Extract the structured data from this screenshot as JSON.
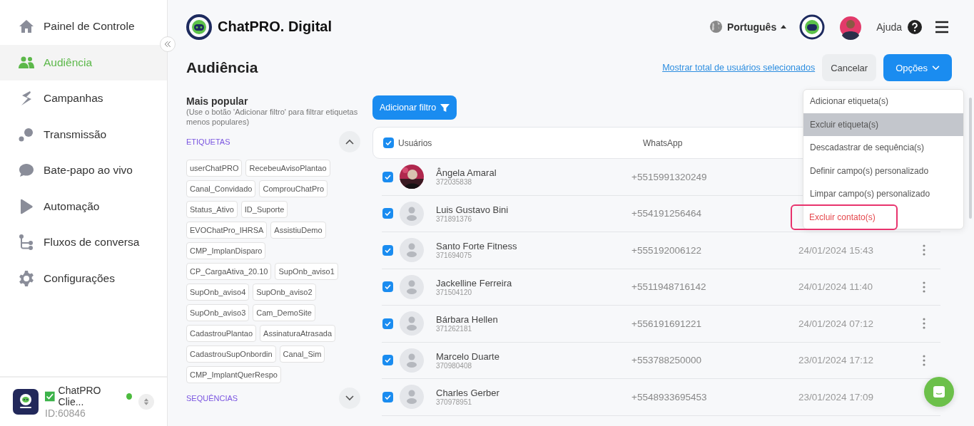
{
  "sidebar": {
    "items": [
      {
        "label": "Painel de Controle",
        "selected": false
      },
      {
        "label": "Audiência",
        "selected": true
      },
      {
        "label": "Campanhas",
        "selected": false
      },
      {
        "label": "Transmissão",
        "selected": false
      },
      {
        "label": "Bate-papo ao vivo",
        "selected": false
      },
      {
        "label": "Automação",
        "selected": false
      },
      {
        "label": "Fluxos de conversa",
        "selected": false
      },
      {
        "label": "Configurações",
        "selected": false
      }
    ],
    "account": {
      "name": "ChatPRO Clie...",
      "id": "ID:60846",
      "verified": true,
      "online": true
    }
  },
  "header": {
    "brand": "ChatPRO. Digital",
    "language": "Português",
    "help": "Ajuda"
  },
  "page": {
    "title": "Audiência",
    "show_total_link": "Mostrar total de usuários selecionados",
    "cancel": "Cancelar",
    "options": "Opções"
  },
  "filters": {
    "title": "Mais popular",
    "hint": "(Use o botão 'Adicionar filtro' para filtrar etiquetas menos populares)",
    "sections": [
      {
        "label": "ETIQUETAS",
        "expanded": true,
        "tags": [
          "userChatPRO",
          "RecebeuAvisoPlantao",
          "Canal_Convidado",
          "ComprouChatPro",
          "Status_Ativo",
          "ID_Suporte",
          "EVOChatPro_IHRSA",
          "AssistiuDemo",
          "CMP_ImplanDisparo",
          "CP_CargaAtiva_20.10",
          "SupOnb_aviso1",
          "SupOnb_aviso4",
          "SupOnb_aviso2",
          "SupOnb_aviso3",
          "Cam_DemoSite",
          "CadastrouPlantao",
          "AssinaturaAtrasada",
          "CadastrouSupOnbordin",
          "Canal_Sim",
          "CMP_ImplantQuerRespo"
        ]
      },
      {
        "label": "SEQUÊNCIAS",
        "expanded": false
      }
    ]
  },
  "add_filter": "Adicionar filtro",
  "table": {
    "all_checked": true,
    "columns": [
      "Usuários",
      "WhatsApp"
    ],
    "rows": [
      {
        "name": "Ângela Amaral",
        "id": "372035838",
        "phone": "+5515991320249",
        "checked": true,
        "has_photo": true
      },
      {
        "name": "Luis Gustavo Bini",
        "id": "371891376",
        "phone": "+554191256464",
        "checked": true,
        "has_photo": false
      },
      {
        "name": "Santo Forte Fitness",
        "id": "371694075",
        "phone": "+555192006122",
        "date": "24/01/2024 15:43",
        "checked": true,
        "has_photo": false
      },
      {
        "name": "Jackelline Ferreira",
        "id": "371504120",
        "phone": "+5511948716142",
        "date": "24/01/2024 11:40",
        "checked": true,
        "has_photo": false
      },
      {
        "name": "Bárbara Hellen",
        "id": "371262181",
        "phone": "+556191691221",
        "date": "24/01/2024 07:12",
        "checked": true,
        "has_photo": false
      },
      {
        "name": "Marcelo Duarte",
        "id": "370980408",
        "phone": "+553788250000",
        "date": "23/01/2024 17:12",
        "checked": true,
        "has_photo": false
      },
      {
        "name": "Charles Gerber",
        "id": "370978951",
        "phone": "+5548933695453",
        "date": "23/01/2024 17:09",
        "checked": true,
        "has_photo": false
      }
    ]
  },
  "options_menu": {
    "items": [
      {
        "label": "Adicionar etiqueta(s)",
        "selected": false,
        "danger": false,
        "outlined": false
      },
      {
        "label": "Excluir etiqueta(s)",
        "selected": true,
        "danger": false,
        "outlined": false
      },
      {
        "label": "Descadastrar de sequência(s)",
        "selected": false,
        "danger": false,
        "outlined": false
      },
      {
        "label": "Definir campo(s) personalizado",
        "selected": false,
        "danger": false,
        "outlined": false
      },
      {
        "label": "Limpar campo(s) personalizado",
        "selected": false,
        "danger": false,
        "outlined": false
      },
      {
        "label": "Excluir contato(s)",
        "selected": false,
        "danger": true,
        "outlined": true
      }
    ]
  }
}
